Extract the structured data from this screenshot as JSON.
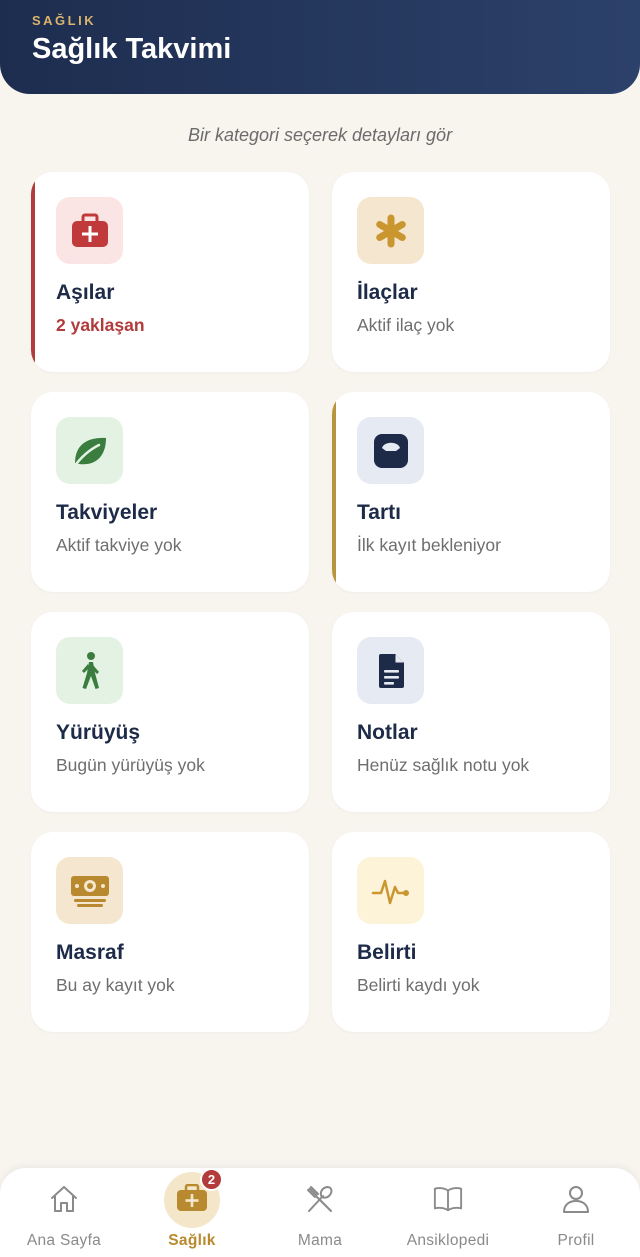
{
  "header": {
    "eyebrow": "SAĞLIK",
    "title": "Sağlık Takvimi"
  },
  "subtitle": "Bir kategori seçerek detayları gör",
  "cards": [
    {
      "title": "Aşılar",
      "subtitle": "2 yaklaşan",
      "icon": "medical-kit-icon",
      "icon_bg": "#fbe4e4",
      "icon_color": "#c0393b",
      "accent": "#b23b3b"
    },
    {
      "title": "İlaçlar",
      "subtitle": "Aktif ilaç yok",
      "icon": "asterisk-icon",
      "icon_bg": "#f5e7cf",
      "icon_color": "#c9962f"
    },
    {
      "title": "Takviyeler",
      "subtitle": "Aktif takviye yok",
      "icon": "leaf-icon",
      "icon_bg": "#e4f2e4",
      "icon_color": "#3a7d3f"
    },
    {
      "title": "Tartı",
      "subtitle": "İlk kayıt bekleniyor",
      "icon": "scale-icon",
      "icon_bg": "#e6eaf2",
      "icon_color": "#1d2b48",
      "accent": "#b8943f"
    },
    {
      "title": "Yürüyüş",
      "subtitle": "Bugün yürüyüş yok",
      "icon": "walking-icon",
      "icon_bg": "#e4f2e4",
      "icon_color": "#3a7d3f"
    },
    {
      "title": "Notlar",
      "subtitle": "Henüz sağlık notu yok",
      "icon": "document-icon",
      "icon_bg": "#e6eaf2",
      "icon_color": "#1d2b48"
    },
    {
      "title": "Masraf",
      "subtitle": "Bu ay kayıt yok",
      "icon": "money-icon",
      "icon_bg": "#f5e7cf",
      "icon_color": "#b8892e"
    },
    {
      "title": "Belirti",
      "subtitle": "Belirti kaydı yok",
      "icon": "pulse-icon",
      "icon_bg": "#fdf3d9",
      "icon_color": "#c9962f"
    }
  ],
  "nav": {
    "items": [
      {
        "label": "Ana Sayfa",
        "icon": "home-icon"
      },
      {
        "label": "Sağlık",
        "icon": "medical-kit-icon",
        "active": true,
        "badge": "2"
      },
      {
        "label": "Mama",
        "icon": "utensils-icon"
      },
      {
        "label": "Ansiklopedi",
        "icon": "book-icon"
      },
      {
        "label": "Profil",
        "icon": "user-icon"
      }
    ]
  },
  "colors": {
    "header_bg": "#1d2d4f",
    "accent_gold": "#b8892e",
    "alert_red": "#b23b3b",
    "page_bg": "#f8f5ef"
  }
}
